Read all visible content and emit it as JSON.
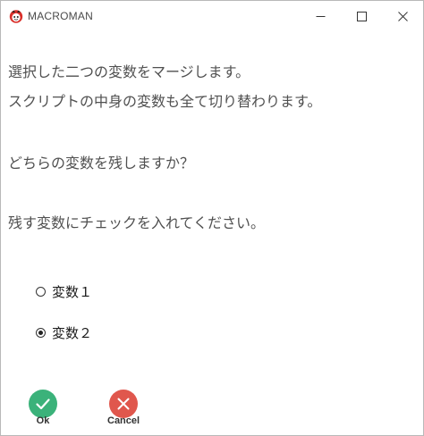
{
  "window": {
    "title": "MACROMAN"
  },
  "message": {
    "line1": "選択した二つの変数をマージします。",
    "line2": "スクリプトの中身の変数も全て切り替わります。",
    "line3": "どちらの変数を残しますか？",
    "line4": "残す変数にチェックを入れてください。"
  },
  "options": [
    {
      "label": "変数１",
      "checked": false
    },
    {
      "label": "変数２",
      "checked": true
    }
  ],
  "actions": {
    "ok_label": "Ok",
    "cancel_label": "Cancel"
  },
  "colors": {
    "ok": "#3bb27a",
    "cancel": "#e0574d",
    "text": "#505050"
  },
  "icons": {
    "app": "red-face-icon",
    "minimize": "minimize-icon",
    "maximize": "maximize-icon",
    "close": "close-icon",
    "ok": "check-icon",
    "cancel": "x-icon"
  }
}
